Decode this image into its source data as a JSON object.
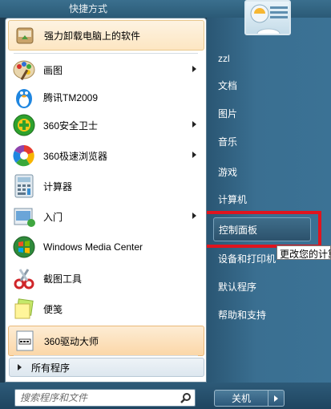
{
  "top": {
    "peek_text": "快捷方式"
  },
  "left_menu": {
    "items": [
      {
        "label": "强力卸载电脑上的软件",
        "icon": "uninstall-icon"
      },
      {
        "label": "画图",
        "icon": "paint-icon",
        "submenu": true
      },
      {
        "label": "腾讯TM2009",
        "icon": "tm-penguin-icon"
      },
      {
        "label": "360安全卫士",
        "icon": "360-safe-icon",
        "submenu": true
      },
      {
        "label": "360极速浏览器",
        "icon": "360-browser-icon",
        "submenu": true
      },
      {
        "label": "计算器",
        "icon": "calculator-icon"
      },
      {
        "label": "入门",
        "icon": "getting-started-icon",
        "submenu": true
      },
      {
        "label": "Windows Media Center",
        "icon": "media-center-icon"
      },
      {
        "label": "截图工具",
        "icon": "snipping-tool-icon"
      },
      {
        "label": "便笺",
        "icon": "sticky-notes-icon"
      },
      {
        "label": "360驱动大师",
        "icon": "driver-master-icon"
      }
    ],
    "all_programs": "所有程序"
  },
  "search": {
    "placeholder": "搜索程序和文件"
  },
  "right_menu": {
    "items": [
      "zzl",
      "文档",
      "图片",
      "音乐",
      "游戏",
      "计算机",
      "控制面板",
      "设备和打印机",
      "默认程序",
      "帮助和支持"
    ],
    "tooltip": "更改您的计算机"
  },
  "shutdown": {
    "label": "关机"
  },
  "colors": {
    "highlight_box": "#e0141e",
    "pane_blue": "#3a6f91"
  }
}
